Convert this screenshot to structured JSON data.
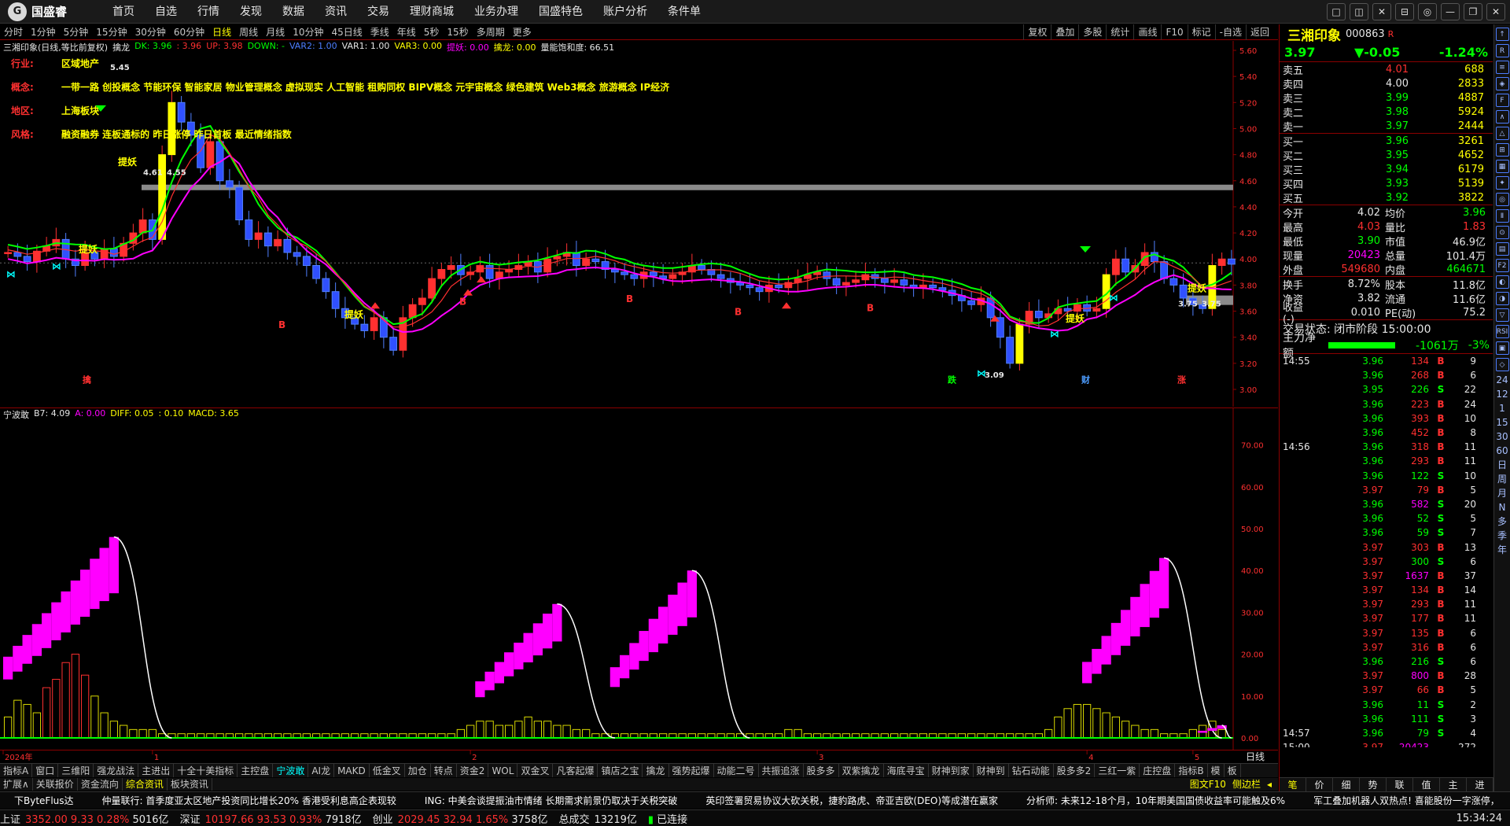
{
  "app": {
    "logo_text": "国盛睿",
    "logo_mark": "G"
  },
  "menu": [
    "首页",
    "自选",
    "行情",
    "发现",
    "数据",
    "资讯",
    "交易",
    "理财商城",
    "业务办理",
    "国盛特色",
    "账户分析",
    "条件单"
  ],
  "window_controls": [
    "□",
    "◫",
    "✕",
    "⊟",
    "◎",
    "—",
    "❐",
    "✕"
  ],
  "periods": {
    "items": [
      "分时",
      "1分钟",
      "5分钟",
      "15分钟",
      "30分钟",
      "60分钟",
      "日线",
      "周线",
      "月线",
      "10分钟",
      "45日线",
      "季线",
      "年线",
      "5秒",
      "15秒",
      "多周期",
      "更多"
    ],
    "active": "日线",
    "right": [
      "复权",
      "叠加",
      "多股",
      "统计",
      "画线",
      "F10",
      "标记",
      "-自选",
      "返回"
    ]
  },
  "main_legend": {
    "title": "三湘印象(日线,等比前复权)",
    "name": "擒龙",
    "dk": "DK: 3.96",
    "dk2": ": 3.96",
    "up": "UP: 3.98",
    "down": "DOWN: -",
    "var2": "VAR2: 1.00",
    "var1": "VAR1: 1.00",
    "var3": "VAR3: 0.00",
    "tiyao": "提妖: 0.00",
    "qinlong": "擒龙: 0.00",
    "baoneng": "量能饱和度: 66.51"
  },
  "info": [
    {
      "k": "行业:",
      "v": "区域地产"
    },
    {
      "k": "概念:",
      "v": "一带一路 创投概念 节能环保 智能家居 物业管理概念 虚拟现实 人工智能 租购同权 BIPV概念 元宇宙概念 绿色建筑 Web3概念 旅游概念 IP经济"
    },
    {
      "k": "地区:",
      "v": "上海板块"
    },
    {
      "k": "风格:",
      "v": "融资融券 连板通标的 昨日涨停 昨日首板 最近情绪指数"
    }
  ],
  "sub_legend": {
    "name": "宁波敢",
    "b7": "B7: 4.09",
    "a": "A: 0.00",
    "diff": "DIFF: 0.05",
    "blank": ": 0.10",
    "macd": "MACD: 3.65"
  },
  "main_axis": {
    "labels": [
      "5.60",
      "5.40",
      "5.20",
      "5.00",
      "4.80",
      "4.60",
      "4.40",
      "4.20",
      "4.00",
      "3.80",
      "3.60",
      "3.40",
      "3.20",
      "3.00"
    ]
  },
  "sub_axis": {
    "labels": [
      "70.00",
      "60.00",
      "50.00",
      "40.00",
      "30.00",
      "20.00",
      "10.00",
      "0.00"
    ]
  },
  "annotations": {
    "high": "5.45",
    "mid": "4.61",
    "mid2": "4.55",
    "low": "3.09",
    "right_low": "3.75",
    "right_low2": "3.75",
    "tiyao": "提妖",
    "b": "B",
    "qin": "擒",
    "die": "跌",
    "cai": "财",
    "zhang": "涨"
  },
  "chart_data": {
    "type": "candlestick",
    "ylim": [
      3.0,
      5.6
    ],
    "sub_ylim": [
      0,
      75
    ],
    "time_axis": [
      "2024年",
      "1",
      "2",
      "3",
      "4",
      "5"
    ],
    "closes": [
      4.05,
      4.02,
      3.98,
      4.06,
      4.1,
      4.15,
      4.0,
      3.95,
      4.05,
      4.0,
      4.08,
      4.02,
      4.12,
      4.2,
      4.3,
      4.15,
      4.8,
      5.2,
      5.05,
      4.95,
      4.7,
      4.9,
      4.6,
      4.55,
      4.3,
      4.15,
      4.2,
      4.1,
      4.15,
      4.05,
      4.02,
      3.95,
      3.85,
      3.75,
      3.62,
      3.55,
      3.5,
      3.45,
      3.55,
      3.4,
      3.3,
      3.55,
      3.65,
      3.7,
      3.85,
      3.92,
      3.95,
      3.88,
      3.9,
      3.95,
      3.85,
      3.9,
      3.92,
      3.95,
      3.98,
      3.9,
      4.0,
      4.02,
      4.05,
      3.95,
      4.0,
      3.98,
      3.92,
      3.9,
      3.88,
      3.85,
      3.9,
      3.87,
      3.85,
      3.88,
      3.9,
      3.95,
      3.92,
      3.88,
      3.85,
      3.82,
      3.8,
      3.78,
      3.75,
      3.8,
      3.78,
      3.82,
      3.85,
      3.88,
      3.9,
      3.85,
      3.8,
      3.82,
      3.84,
      3.88,
      3.85,
      3.82,
      3.84,
      3.8,
      3.78,
      3.8,
      3.78,
      3.76,
      3.72,
      3.68,
      3.65,
      3.7,
      3.55,
      3.4,
      3.2,
      3.5,
      3.6,
      3.55,
      3.58,
      3.62,
      3.6,
      3.65,
      3.6,
      3.62,
      3.88,
      4.0,
      3.9,
      3.95,
      4.05,
      3.98,
      3.85,
      3.8,
      3.7,
      3.65,
      3.62,
      3.95,
      4.0,
      3.96
    ],
    "sub_values": [
      5,
      9,
      8,
      6,
      12,
      14,
      18,
      20,
      15,
      10,
      6,
      4,
      3,
      2,
      2,
      2,
      1,
      1,
      1,
      1,
      1,
      1,
      1,
      1,
      1,
      1,
      1,
      1,
      1,
      1,
      1,
      1,
      1,
      1,
      1,
      1,
      1,
      1,
      1,
      1,
      1,
      1,
      1,
      1,
      1,
      1,
      1,
      2,
      3,
      4,
      4,
      3,
      3,
      4,
      5,
      4,
      4,
      3,
      3,
      2,
      2,
      1,
      1,
      1,
      1,
      1,
      1,
      1,
      1,
      1,
      1,
      1,
      1,
      1,
      1,
      1,
      1,
      1,
      1,
      1,
      1,
      2,
      2,
      1,
      1,
      1,
      1,
      1,
      1,
      1,
      1,
      1,
      1,
      1,
      1,
      1,
      1,
      1,
      1,
      1,
      1,
      1,
      1,
      1,
      1,
      1,
      1,
      1,
      2,
      5,
      7,
      8,
      8,
      7,
      6,
      5,
      4,
      3,
      2,
      2,
      1,
      1,
      1,
      2,
      3,
      4,
      2
    ],
    "sub_magenta_blocks": [
      {
        "start": 0,
        "end": 11,
        "top": 48
      },
      {
        "start": 49,
        "end": 57,
        "top": 32
      },
      {
        "start": 63,
        "end": 71,
        "top": 40
      },
      {
        "start": 112,
        "end": 120,
        "top": 43
      },
      {
        "start": 124,
        "end": 126,
        "top": 3
      }
    ]
  },
  "indicator_tabs": {
    "items": [
      "指标A",
      "窗口",
      "三维阳",
      "强龙战法",
      "主进出",
      "十全十美指标",
      "主控盘",
      "宁波敢",
      "AI龙",
      "MAKD",
      "低金叉",
      "加仓",
      "转点",
      "资金2",
      "WOL",
      "双金叉",
      "凡客起爆",
      "镇店之宝",
      "擒龙",
      "强势起爆",
      "动能二号",
      "共振追涨",
      "股多多",
      "双紫擒龙",
      "海底寻宝",
      "财神到家",
      "财神到",
      "钻石动能",
      "股多多2",
      "三红一紫",
      "庄控盘",
      "指标B",
      "模",
      "板"
    ],
    "active": "宁波敢"
  },
  "ext_tabs": {
    "items": [
      "扩展∧",
      "关联报价",
      "资金流向",
      "综合资讯",
      "板块资讯"
    ],
    "active": "综合资讯",
    "right": [
      "图文F10",
      "侧边栏",
      "◂"
    ]
  },
  "ticker": [
    "下ByteFlus达",
    "仲量联行: 首季度亚太区地产投资同比增长20% 香港受利息高企表现较",
    "ING: 中美会谈提振油市情绪 长期需求前景仍取决于关税突破",
    "英印签署贸易协议大砍关税，捷豹路虎、帝亚吉欧(DEO)等成潜在赢家",
    "分析师: 未来12-18个月，10年期美国国债收益率可能触及6%",
    "军工叠加机器人双热点! 喜能股份一字涨停，"
  ],
  "status": [
    {
      "label": "上证",
      "v1": "3352.00",
      "v2": "9.33",
      "v3": "0.28%",
      "v4": "5016亿"
    },
    {
      "label": "深证",
      "v1": "10197.66",
      "v2": "93.53",
      "v3": "0.93%",
      "v4": "7918亿"
    },
    {
      "label": "创业",
      "v1": "2029.45",
      "v2": "32.94",
      "v3": "1.65%",
      "v4": "3758亿"
    }
  ],
  "status_extra": {
    "total_label": "总成交",
    "total": "13219亿",
    "conn": "已连接",
    "time": "15:34:24"
  },
  "quote": {
    "name": "三湘印象",
    "code": "000863",
    "flag": "R",
    "price": "3.97",
    "change": "-0.05",
    "pct": "-1.24%",
    "asks": [
      {
        "l": "卖五",
        "p": "4.01",
        "v": "688",
        "c": "red"
      },
      {
        "l": "卖四",
        "p": "4.00",
        "v": "2833",
        "c": "wht"
      },
      {
        "l": "卖三",
        "p": "3.99",
        "v": "4887",
        "c": "grn"
      },
      {
        "l": "卖二",
        "p": "3.98",
        "v": "5924",
        "c": "grn"
      },
      {
        "l": "卖一",
        "p": "3.97",
        "v": "2444",
        "c": "grn"
      }
    ],
    "bids": [
      {
        "l": "买一",
        "p": "3.96",
        "v": "3261",
        "c": "grn"
      },
      {
        "l": "买二",
        "p": "3.95",
        "v": "4652",
        "c": "grn"
      },
      {
        "l": "买三",
        "p": "3.94",
        "v": "6179",
        "c": "grn"
      },
      {
        "l": "买四",
        "p": "3.93",
        "v": "5139",
        "c": "grn"
      },
      {
        "l": "买五",
        "p": "3.92",
        "v": "3822",
        "c": "grn"
      }
    ],
    "stats": [
      {
        "k1": "今开",
        "v1": "4.02",
        "c1": "wht",
        "k2": "均价",
        "v2": "3.96",
        "c2": "grn"
      },
      {
        "k1": "最高",
        "v1": "4.03",
        "c1": "red",
        "k2": "量比",
        "v2": "1.83",
        "c2": "red"
      },
      {
        "k1": "最低",
        "v1": "3.90",
        "c1": "grn",
        "k2": "市值",
        "v2": "46.9亿",
        "c2": "wht"
      },
      {
        "k1": "现量",
        "v1": "20423",
        "c1": "mag",
        "k2": "总量",
        "v2": "101.4万",
        "c2": "wht"
      },
      {
        "k1": "外盘",
        "v1": "549680",
        "c1": "red",
        "k2": "内盘",
        "v2": "464671",
        "c2": "grn"
      }
    ],
    "stats2": [
      {
        "k1": "换手",
        "v1": "8.72%",
        "c1": "wht",
        "k2": "股本",
        "v2": "11.8亿",
        "c2": "wht"
      },
      {
        "k1": "净资",
        "v1": "3.82",
        "c1": "wht",
        "k2": "流通",
        "v2": "11.6亿",
        "c2": "wht"
      },
      {
        "k1": "收益(-)",
        "v1": "0.010",
        "c1": "wht",
        "k2": "PE(动)",
        "v2": "75.2",
        "c2": "wht"
      }
    ],
    "state": "交易状态: 闭市阶段 15:00:00",
    "flow": {
      "label": "主力净额",
      "value": "-1061万",
      "pct": "-3%"
    },
    "ticks": [
      {
        "t": "14:55",
        "p": "3.96",
        "v": "134",
        "bs": "B",
        "n": "9"
      },
      {
        "t": "",
        "p": "3.96",
        "v": "268",
        "bs": "B",
        "n": "6"
      },
      {
        "t": "",
        "p": "3.95",
        "v": "226",
        "bs": "S",
        "n": "22"
      },
      {
        "t": "",
        "p": "3.96",
        "v": "223",
        "bs": "B",
        "n": "24"
      },
      {
        "t": "",
        "p": "3.96",
        "v": "393",
        "bs": "B",
        "n": "10"
      },
      {
        "t": "",
        "p": "3.96",
        "v": "452",
        "bs": "B",
        "n": "8"
      },
      {
        "t": "14:56",
        "p": "3.96",
        "v": "318",
        "bs": "B",
        "n": "11"
      },
      {
        "t": "",
        "p": "3.96",
        "v": "293",
        "bs": "B",
        "n": "11"
      },
      {
        "t": "",
        "p": "3.96",
        "v": "122",
        "bs": "S",
        "n": "10"
      },
      {
        "t": "",
        "p": "3.97",
        "v": "79",
        "bs": "B",
        "n": "5"
      },
      {
        "t": "",
        "p": "3.96",
        "v": "582",
        "bs": "S",
        "n": "20"
      },
      {
        "t": "",
        "p": "3.96",
        "v": "52",
        "bs": "S",
        "n": "5"
      },
      {
        "t": "",
        "p": "3.96",
        "v": "59",
        "bs": "S",
        "n": "7"
      },
      {
        "t": "",
        "p": "3.97",
        "v": "303",
        "bs": "B",
        "n": "13"
      },
      {
        "t": "",
        "p": "3.97",
        "v": "300",
        "bs": "S",
        "n": "6"
      },
      {
        "t": "",
        "p": "3.97",
        "v": "1637",
        "bs": "B",
        "n": "37"
      },
      {
        "t": "",
        "p": "3.97",
        "v": "134",
        "bs": "B",
        "n": "14"
      },
      {
        "t": "",
        "p": "3.97",
        "v": "293",
        "bs": "B",
        "n": "11"
      },
      {
        "t": "",
        "p": "3.97",
        "v": "177",
        "bs": "B",
        "n": "11"
      },
      {
        "t": "",
        "p": "3.97",
        "v": "135",
        "bs": "B",
        "n": "6"
      },
      {
        "t": "",
        "p": "3.97",
        "v": "316",
        "bs": "B",
        "n": "6"
      },
      {
        "t": "",
        "p": "3.96",
        "v": "216",
        "bs": "S",
        "n": "6"
      },
      {
        "t": "",
        "p": "3.97",
        "v": "800",
        "bs": "B",
        "n": "28"
      },
      {
        "t": "",
        "p": "3.97",
        "v": "66",
        "bs": "B",
        "n": "5"
      },
      {
        "t": "",
        "p": "3.96",
        "v": "11",
        "bs": "S",
        "n": "2"
      },
      {
        "t": "",
        "p": "3.96",
        "v": "111",
        "bs": "S",
        "n": "3"
      },
      {
        "t": "14:57",
        "p": "3.96",
        "v": "79",
        "bs": "S",
        "n": "4"
      },
      {
        "t": "15:00",
        "p": "3.97",
        "v": "20423",
        "bs": "",
        "n": "272"
      }
    ],
    "bottom_tabs": [
      "笔",
      "价",
      "细",
      "势",
      "联",
      "值",
      "主",
      "进"
    ],
    "bottom_active": "笔"
  },
  "side_strip": {
    "boxes": [
      "↑",
      "R",
      "≡",
      "◈",
      "F",
      "∧",
      "△",
      "⊞",
      "▦",
      "✦",
      "◎",
      "Ⅱ",
      "⊙",
      "▤",
      "F2",
      "◐",
      "◑",
      "▽",
      "RSI",
      "▣",
      "◇"
    ],
    "labels": [
      "24",
      "12",
      "1",
      "15",
      "30",
      "60",
      "日",
      "周",
      "月",
      "N",
      "多",
      "季",
      "年"
    ]
  },
  "colors": {
    "up": "#ff3030",
    "down": "#00ffff",
    "ma1": "#00ff00",
    "ma2": "#ff00ff",
    "ma3": "#ff3030",
    "accent": "#ffff00",
    "border": "#8b0000"
  }
}
